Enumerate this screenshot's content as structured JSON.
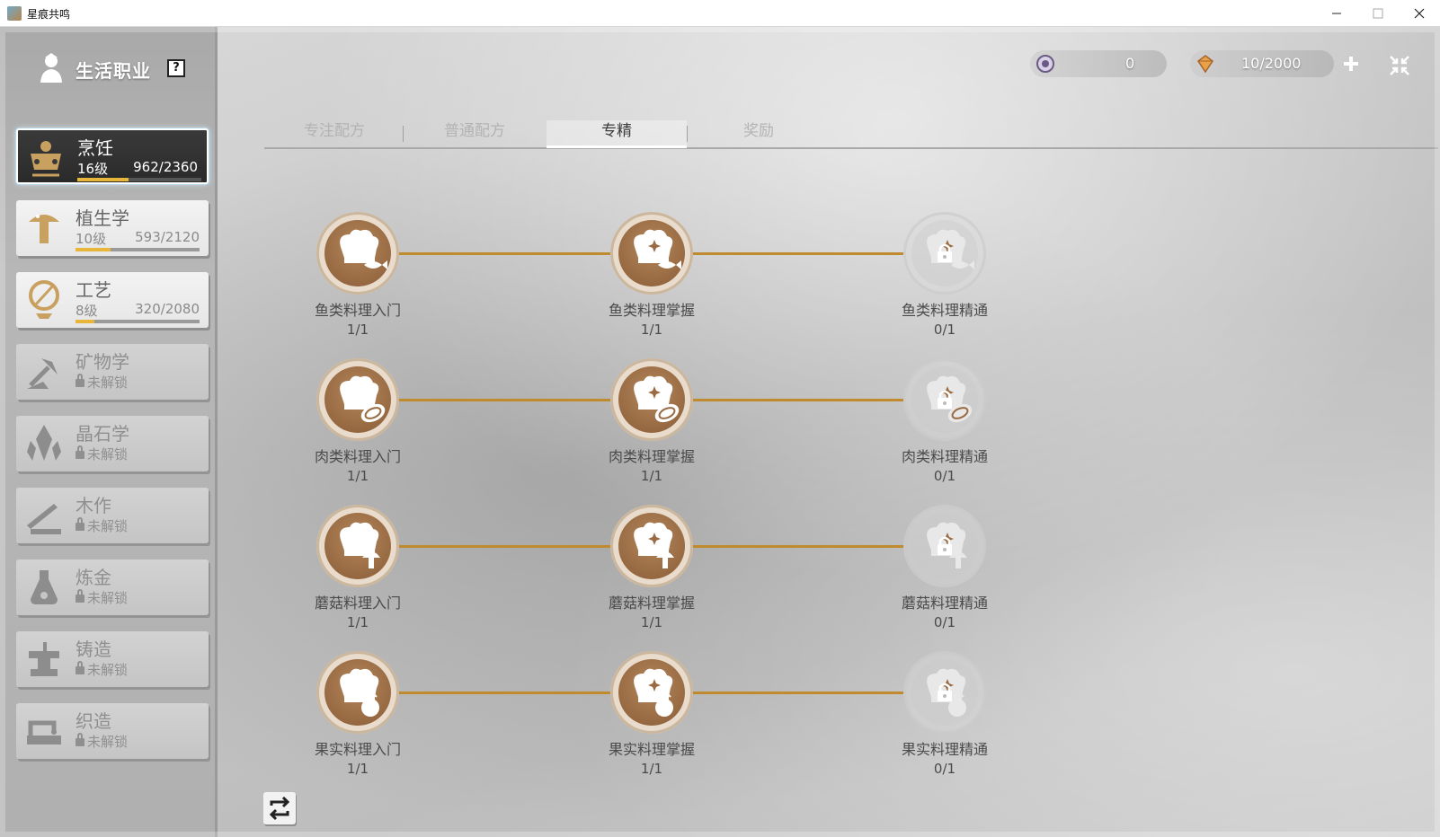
{
  "window": {
    "title": "星痕共鸣"
  },
  "sidebar": {
    "title": "生活职业",
    "help": "?",
    "careers": [
      {
        "name": "烹饪",
        "level": "16级",
        "xp": "962/2360",
        "progress": 0.41,
        "state": "selected"
      },
      {
        "name": "植生学",
        "level": "10级",
        "xp": "593/2120",
        "progress": 0.28,
        "state": "normal"
      },
      {
        "name": "工艺",
        "level": "8级",
        "xp": "320/2080",
        "progress": 0.15,
        "state": "normal"
      },
      {
        "name": "矿物学",
        "lock": "未解锁",
        "state": "locked"
      },
      {
        "name": "晶石学",
        "lock": "未解锁",
        "state": "locked"
      },
      {
        "name": "木作",
        "lock": "未解锁",
        "state": "locked"
      },
      {
        "name": "炼金",
        "lock": "未解锁",
        "state": "locked"
      },
      {
        "name": "铸造",
        "lock": "未解锁",
        "state": "locked"
      },
      {
        "name": "织造",
        "lock": "未解锁",
        "state": "locked"
      }
    ]
  },
  "resources": {
    "coin": "0",
    "energy": "10/2000"
  },
  "tabs": [
    {
      "label": "专注配方",
      "active": false
    },
    {
      "label": "普通配方",
      "active": false
    },
    {
      "label": "专精",
      "active": true
    },
    {
      "label": "奖励",
      "active": false
    }
  ],
  "tree": [
    {
      "nodes": [
        {
          "name": "鱼类料理入门",
          "count": "1/1",
          "locked": false,
          "icon": "fish-dish-icon"
        },
        {
          "name": "鱼类料理掌握",
          "count": "1/1",
          "locked": false,
          "icon": "fish-dish-icon"
        },
        {
          "name": "鱼类料理精通",
          "count": "0/1",
          "locked": true,
          "icon": "fish-dish-icon"
        }
      ]
    },
    {
      "nodes": [
        {
          "name": "肉类料理入门",
          "count": "1/1",
          "locked": false,
          "icon": "meat-dish-icon"
        },
        {
          "name": "肉类料理掌握",
          "count": "1/1",
          "locked": false,
          "icon": "meat-dish-icon"
        },
        {
          "name": "肉类料理精通",
          "count": "0/1",
          "locked": true,
          "icon": "meat-dish-icon"
        }
      ]
    },
    {
      "nodes": [
        {
          "name": "蘑菇料理入门",
          "count": "1/1",
          "locked": false,
          "icon": "mushroom-dish-icon"
        },
        {
          "name": "蘑菇料理掌握",
          "count": "1/1",
          "locked": false,
          "icon": "mushroom-dish-icon"
        },
        {
          "name": "蘑菇料理精通",
          "count": "0/1",
          "locked": true,
          "icon": "mushroom-dish-icon"
        }
      ]
    },
    {
      "nodes": [
        {
          "name": "果实料理入门",
          "count": "1/1",
          "locked": false,
          "icon": "fruit-dish-icon"
        },
        {
          "name": "果实料理掌握",
          "count": "1/1",
          "locked": false,
          "icon": "fruit-dish-icon"
        },
        {
          "name": "果实料理精通",
          "count": "0/1",
          "locked": true,
          "icon": "fruit-dish-icon"
        }
      ]
    }
  ],
  "colors": {
    "accent": "#c08a2e",
    "node": "#9a6b43",
    "xp_bar": "#e8b63a"
  }
}
